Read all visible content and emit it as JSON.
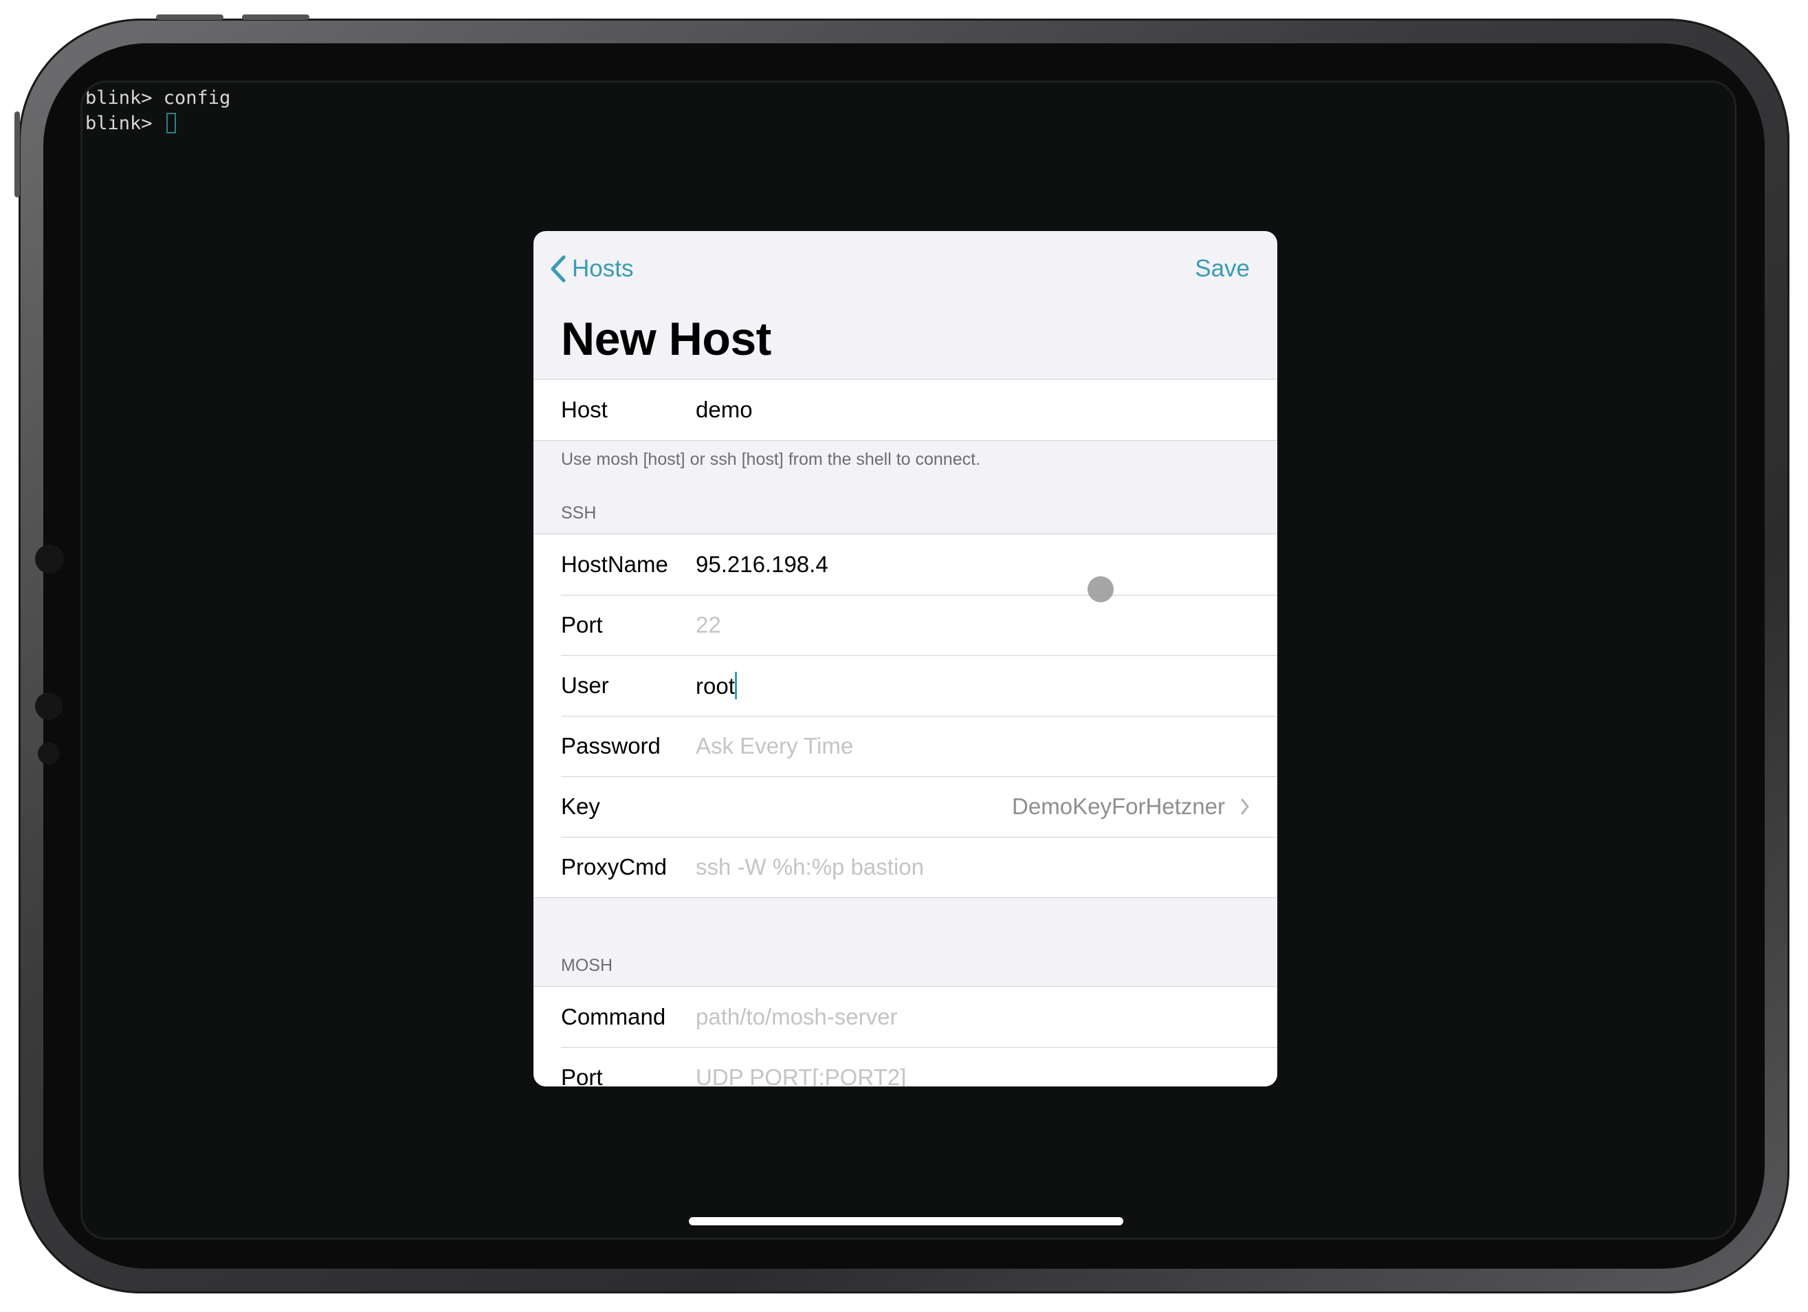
{
  "terminal": {
    "lines": [
      "blink> config",
      "blink> "
    ]
  },
  "navbar": {
    "back_label": "Hosts",
    "save_label": "Save",
    "title": "New Host"
  },
  "host_section": {
    "label": "Host",
    "value": "demo",
    "footer": "Use mosh [host] or ssh [host] from the shell to connect."
  },
  "ssh_section": {
    "header": "SSH",
    "hostname": {
      "label": "HostName",
      "value": "95.216.198.4"
    },
    "port": {
      "label": "Port",
      "placeholder": "22"
    },
    "user": {
      "label": "User",
      "value": "root"
    },
    "password": {
      "label": "Password",
      "placeholder": "Ask Every Time"
    },
    "key": {
      "label": "Key",
      "value": "DemoKeyForHetzner"
    },
    "proxycmd": {
      "label": "ProxyCmd",
      "placeholder": "ssh -W %h:%p bastion"
    }
  },
  "mosh_section": {
    "header": "MOSH",
    "command": {
      "label": "Command",
      "placeholder": "path/to/mosh-server"
    },
    "port": {
      "label": "Port",
      "placeholder": "UDP PORT[:PORT2]"
    }
  },
  "colors": {
    "accent": "#3a9bb6",
    "modal_background": "#f2f2f7",
    "terminal_background": "#0e0f0f",
    "placeholder_text": "#c4c4c8"
  }
}
